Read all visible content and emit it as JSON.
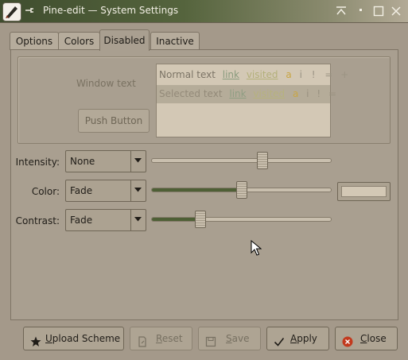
{
  "window": {
    "title": "Pine-edit — System Settings"
  },
  "tabs": [
    {
      "label": "Options",
      "active": false
    },
    {
      "label": "Colors",
      "active": false
    },
    {
      "label": "Disabled",
      "active": true
    },
    {
      "label": "Inactive",
      "active": false
    }
  ],
  "preview": {
    "window_text": "Window text",
    "push_button": "Push Button",
    "normal_row": {
      "text": "Normal text",
      "link": "link",
      "visited": "visited",
      "symbols": [
        "a",
        "i",
        "!",
        "=",
        "+"
      ]
    },
    "selected_row": {
      "text": "Selected text",
      "link": "link",
      "visited": "visited",
      "symbols": [
        "a",
        "i",
        "!",
        "="
      ]
    }
  },
  "effects": {
    "intensity": {
      "label": "Intensity:",
      "value": "None",
      "slider_fraction": 0.62
    },
    "color": {
      "label": "Color:",
      "value": "Fade",
      "slider_fraction": 0.5,
      "swatch_color": "#d3c8b5"
    },
    "contrast": {
      "label": "Contrast:",
      "value": "Fade",
      "slider_fraction": 0.27
    }
  },
  "buttons": {
    "upload_scheme": "Upload Scheme",
    "reset": "Reset",
    "save": "Save",
    "apply": "Apply",
    "close": "Close"
  },
  "colors": {
    "title_bar": "#4b5a35",
    "slider_fill": "#4e5f35",
    "window_bg": "#a99f90",
    "close_icon": "#c23a1e",
    "link": "#8a9b7e",
    "visited": "#b3b07a"
  }
}
